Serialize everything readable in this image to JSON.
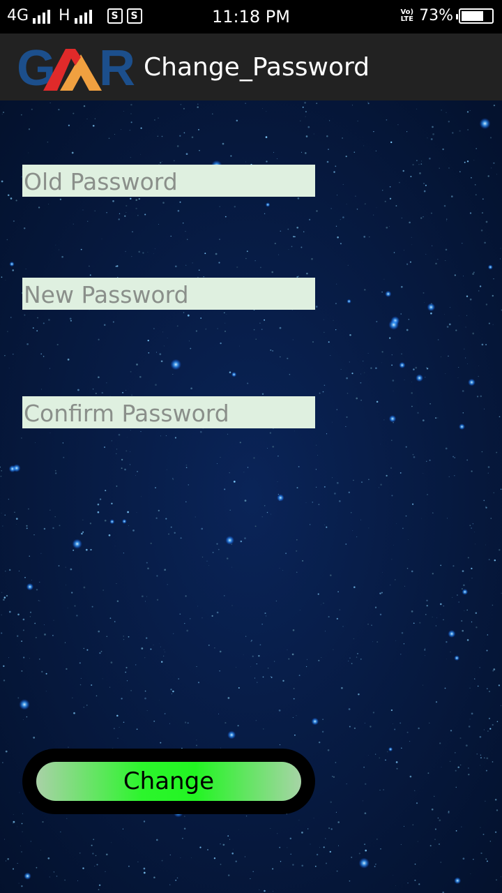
{
  "status_bar": {
    "network1": "4G",
    "network2": "H",
    "sim1": "S",
    "sim2": "S",
    "time": "11:18 PM",
    "volte_top": "Vo)",
    "volte_bottom": "LTE",
    "battery_percent_label": "73%",
    "battery_level": 0.73
  },
  "app_bar": {
    "logo_text": "GMR",
    "title": "Change_Password"
  },
  "form": {
    "old_password": {
      "placeholder": "Old Password",
      "value": ""
    },
    "new_password": {
      "placeholder": "New Password",
      "value": ""
    },
    "confirm_password": {
      "placeholder": "Confirm Password",
      "value": ""
    },
    "submit_label": "Change"
  },
  "colors": {
    "background": "#061633",
    "app_bar": "#222222",
    "field_bg": "#dff0e0",
    "button_green": "#22f522",
    "logo_blue": "#1c4f8c",
    "logo_red": "#e02a2a",
    "logo_orange": "#f0a040"
  }
}
